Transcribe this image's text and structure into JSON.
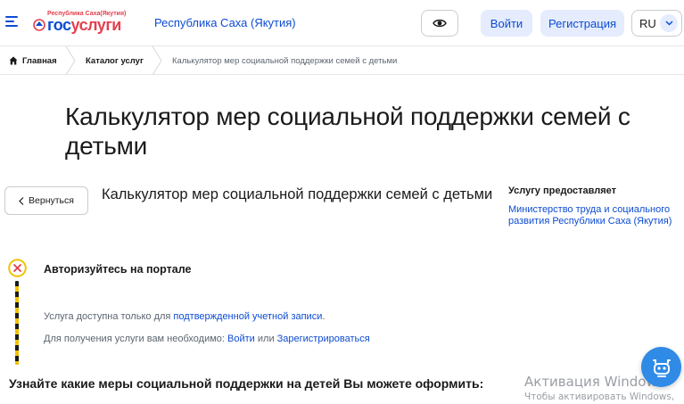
{
  "header": {
    "logo_region": "Республика Саха(Якутия)",
    "logo_part1": "гос",
    "logo_part2": "услуги",
    "region_name": "Республика Саха (Якутия)",
    "login_label": "Войти",
    "register_label": "Регистрация",
    "lang_label": "RU"
  },
  "breadcrumbs": {
    "home": "Главная",
    "catalog": "Каталог услуг",
    "current": "Калькулятор мер социальной поддержки семей с детьми"
  },
  "page": {
    "title": "Калькулятор мер социальной поддержки семей с детьми",
    "back_label": "Вернуться",
    "service_title": "Калькулятор мер социальной поддержки семей с детьми",
    "provider_label": "Услугу предоставляет",
    "provider_name": "Министерство труда и социального развития Республики Саха (Якутия)"
  },
  "auth": {
    "title": "Авторизуйтесь на портале",
    "p1_text": "Услуга доступна только для ",
    "p1_link": "подтвержденной учетной записи",
    "p1_end": ".",
    "p2_text": "Для получения услуги вам необходимо: ",
    "p2_link1": "Войти",
    "p2_mid": " или ",
    "p2_link2": "Зарегистрироваться"
  },
  "bottom_heading": "Узнайте какие меры социальной поддержки на детей Вы можете оформить:",
  "watermark": {
    "title": "Активация Windows",
    "subtitle": "Чтобы активировать Windows,"
  },
  "colors": {
    "brand_blue": "#0d4cd3",
    "brand_red": "#e3404d",
    "button_bg": "#e4ecfd",
    "warning_yellow": "#f2c200"
  },
  "icons": {
    "menu": "burger-icon",
    "accessibility": "eye-icon",
    "home": "home-icon",
    "back": "chevron-left-icon",
    "auth_status": "close-circle-icon",
    "assistant": "robot-icon"
  }
}
